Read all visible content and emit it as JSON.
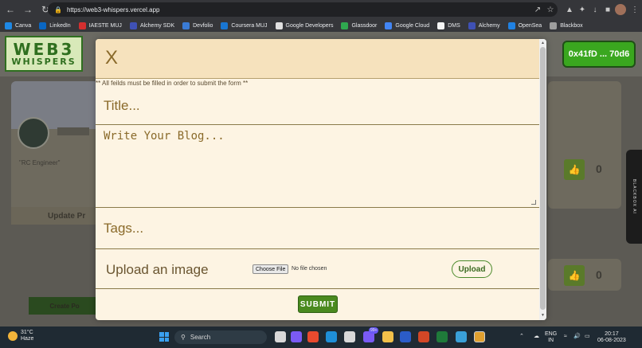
{
  "browser": {
    "url": "https://web3-whispers.vercel.app",
    "bookmarks": [
      "Canva",
      "LinkedIn",
      "IAESTE MUJ",
      "Alchemy SDK",
      "Devfolio",
      "Coursera MUJ",
      "Google Developers",
      "Glassdoor",
      "Google Cloud",
      "DMS",
      "Alchemy",
      "OpenSea",
      "Blackbox"
    ],
    "bookmark_colors": [
      "#1e88e5",
      "#0a66c2",
      "#d32f2f",
      "#3f51b5",
      "#3a7bd5",
      "#1976d2",
      "#e0e0e0",
      "#2fa84f",
      "#4285f4",
      "#f5f5f5",
      "#3f51b5",
      "#2081e2",
      "#9e9e9e"
    ]
  },
  "site": {
    "logo_line1": "WEB3",
    "logo_line2": "WHISPERS",
    "wallet": "0x41fD ... 70d6",
    "background_quote": "\"RC Engineer\"",
    "update_label": "Update Pr",
    "create_label": "Create Po",
    "likes_1": "0",
    "likes_2": "0",
    "blackbox_tab": "BLACKBOX AI"
  },
  "modal": {
    "close": "X",
    "note": "** All feilds must be filled in order to submit the form **",
    "title_placeholder": "Title...",
    "blog_placeholder": "Write Your Blog...",
    "tags_placeholder": "Tags...",
    "upload_label": "Upload an image",
    "choose_file": "Choose File",
    "no_file": "No file chosen",
    "upload_button": "Upload",
    "submit": "SUBMIT"
  },
  "taskbar": {
    "temp": "31°C",
    "weather": "Haze",
    "search": "Search",
    "lang1": "ENG",
    "lang2": "IN",
    "time": "20:17",
    "date": "06-08-2023",
    "badge": "99+"
  }
}
